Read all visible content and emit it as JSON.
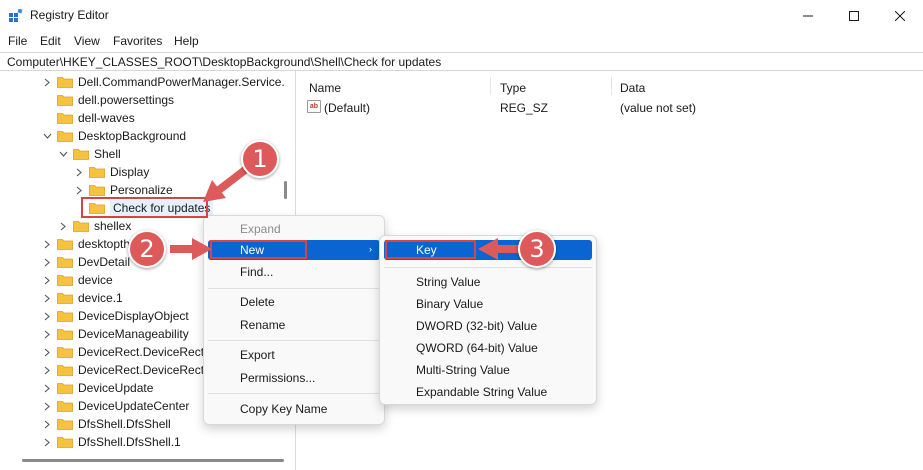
{
  "window": {
    "title": "Registry Editor",
    "icon": "registry-icon"
  },
  "window_controls": [
    "minimize-icon",
    "maximize-icon",
    "close-icon"
  ],
  "menubar": {
    "items": [
      "File",
      "Edit",
      "View",
      "Favorites",
      "Help"
    ]
  },
  "address": {
    "path": "Computer\\HKEY_CLASSES_ROOT\\DesktopBackground\\Shell\\Check for updates"
  },
  "tree": {
    "items": [
      {
        "label": "Dell.CommandPowerManager.Service.",
        "expander": "collapsed"
      },
      {
        "label": "dell.powersettings",
        "expander": "none"
      },
      {
        "label": "dell-waves",
        "expander": "none"
      },
      {
        "label": "DesktopBackground",
        "expander": "expanded"
      },
      {
        "label": "Shell",
        "expander": "expanded"
      },
      {
        "label": "Display",
        "expander": "collapsed"
      },
      {
        "label": "Personalize",
        "expander": "collapsed"
      },
      {
        "label": "Check for updates",
        "expander": "none",
        "selected": true
      },
      {
        "label": "shellex",
        "expander": "collapsed"
      },
      {
        "label": "desktopth",
        "expander": "collapsed"
      },
      {
        "label": "DevDetail",
        "expander": "collapsed"
      },
      {
        "label": "device",
        "expander": "collapsed"
      },
      {
        "label": "device.1",
        "expander": "collapsed"
      },
      {
        "label": "DeviceDisplayObject",
        "expander": "collapsed"
      },
      {
        "label": "DeviceManageability",
        "expander": "collapsed"
      },
      {
        "label": "DeviceRect.DeviceRect",
        "expander": "collapsed"
      },
      {
        "label": "DeviceRect.DeviceRect.1",
        "expander": "collapsed"
      },
      {
        "label": "DeviceUpdate",
        "expander": "collapsed"
      },
      {
        "label": "DeviceUpdateCenter",
        "expander": "collapsed"
      },
      {
        "label": "DfsShell.DfsShell",
        "expander": "collapsed"
      },
      {
        "label": "DfsShell.DfsShell.1",
        "expander": "collapsed"
      }
    ]
  },
  "list": {
    "columns": [
      "Name",
      "Type",
      "Data"
    ],
    "rows": [
      {
        "icon": "ab",
        "name": "(Default)",
        "type": "REG_SZ",
        "data": "(value not set)"
      }
    ]
  },
  "context_menu": {
    "items": {
      "expand": "Expand",
      "new": "New",
      "find": "Find...",
      "delete": "Delete",
      "rename": "Rename",
      "export": "Export",
      "permissions": "Permissions...",
      "copy_key_name": "Copy Key Name"
    }
  },
  "submenu": {
    "items": {
      "key": "Key",
      "string": "String Value",
      "binary": "Binary Value",
      "dword": "DWORD (32-bit) Value",
      "qword": "QWORD (64-bit) Value",
      "multi": "Multi-String Value",
      "expandable": "Expandable String Value"
    }
  },
  "callouts": [
    "1",
    "2",
    "3"
  ],
  "colors": {
    "accent": "#0a64d2",
    "callout": "#dc5a5a",
    "highlight_box": "#d64545",
    "folder": "#f5c242"
  }
}
